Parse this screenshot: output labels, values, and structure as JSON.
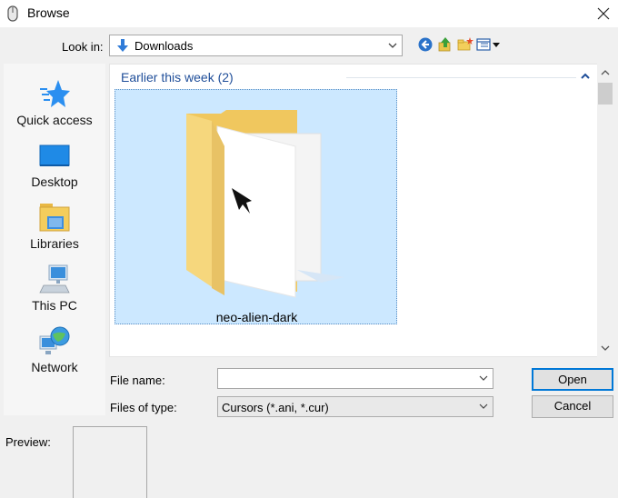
{
  "window": {
    "title": "Browse",
    "icons": {
      "app": "mouse-icon",
      "close": "close-icon"
    }
  },
  "lookin": {
    "label": "Look in:",
    "value": "Downloads",
    "icon": "downloads-folder-icon",
    "toolbar": [
      "back-icon",
      "up-folder-icon",
      "new-folder-icon",
      "view-menu-icon"
    ]
  },
  "places": [
    {
      "label": "Quick access",
      "icon": "star-icon"
    },
    {
      "label": "Desktop",
      "icon": "desktop-icon"
    },
    {
      "label": "Libraries",
      "icon": "libraries-icon"
    },
    {
      "label": "This PC",
      "icon": "computer-icon"
    },
    {
      "label": "Network",
      "icon": "network-icon"
    }
  ],
  "filelist": {
    "group_header": "Earlier this week (2)",
    "items": [
      {
        "name": "neo-alien-dark",
        "icon": "folder-icon",
        "selected": true
      }
    ]
  },
  "fields": {
    "filename_label": "File name:",
    "filename_value": "",
    "filetype_label": "Files of type:",
    "filetype_value": "Cursors (*.ani, *.cur)"
  },
  "buttons": {
    "open": "Open",
    "cancel": "Cancel"
  },
  "preview": {
    "label": "Preview:"
  },
  "colors": {
    "accent": "#0078d7",
    "selection": "#cce8ff",
    "group_header": "#1f4e99"
  }
}
